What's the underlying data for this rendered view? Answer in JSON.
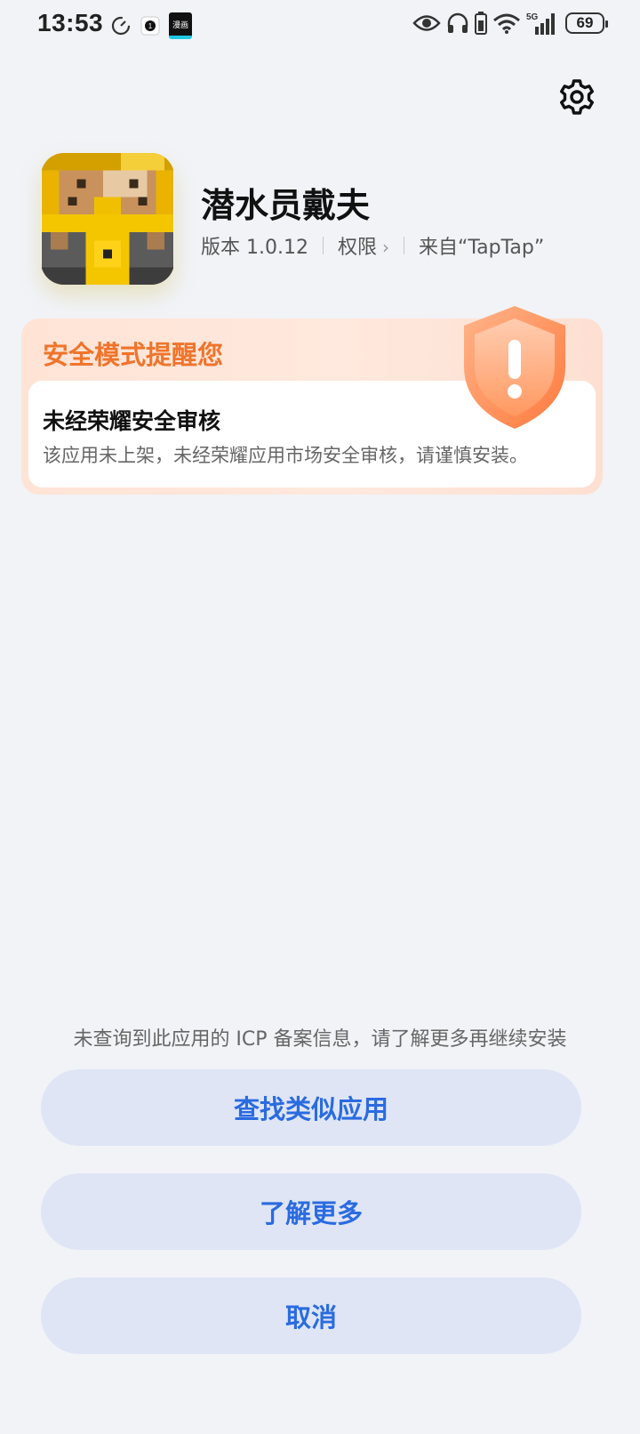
{
  "status_bar": {
    "time": "13:53",
    "app_icon_text": "漫画",
    "battery": "69",
    "network": "5G"
  },
  "app": {
    "name": "潜水员戴夫",
    "version": "版本 1.0.12",
    "permissions": "权限",
    "source": "来自“TapTap”"
  },
  "safety": {
    "title": "安全模式提醒您",
    "heading": "未经荣耀安全审核",
    "description": "该应用未上架，未经荣耀应用市场安全审核，请谨慎安装。"
  },
  "bottom": {
    "icp_note": "未查询到此应用的 ICP 备案信息，请了解更多再继续安装",
    "find_similar": "查找类似应用",
    "learn_more": "了解更多",
    "cancel": "取消"
  },
  "colors": {
    "accent_blue": "#2a6be0",
    "warning_orange": "#f0742b",
    "button_bg": "#dfe5f5",
    "page_bg": "#f1f3f7"
  }
}
